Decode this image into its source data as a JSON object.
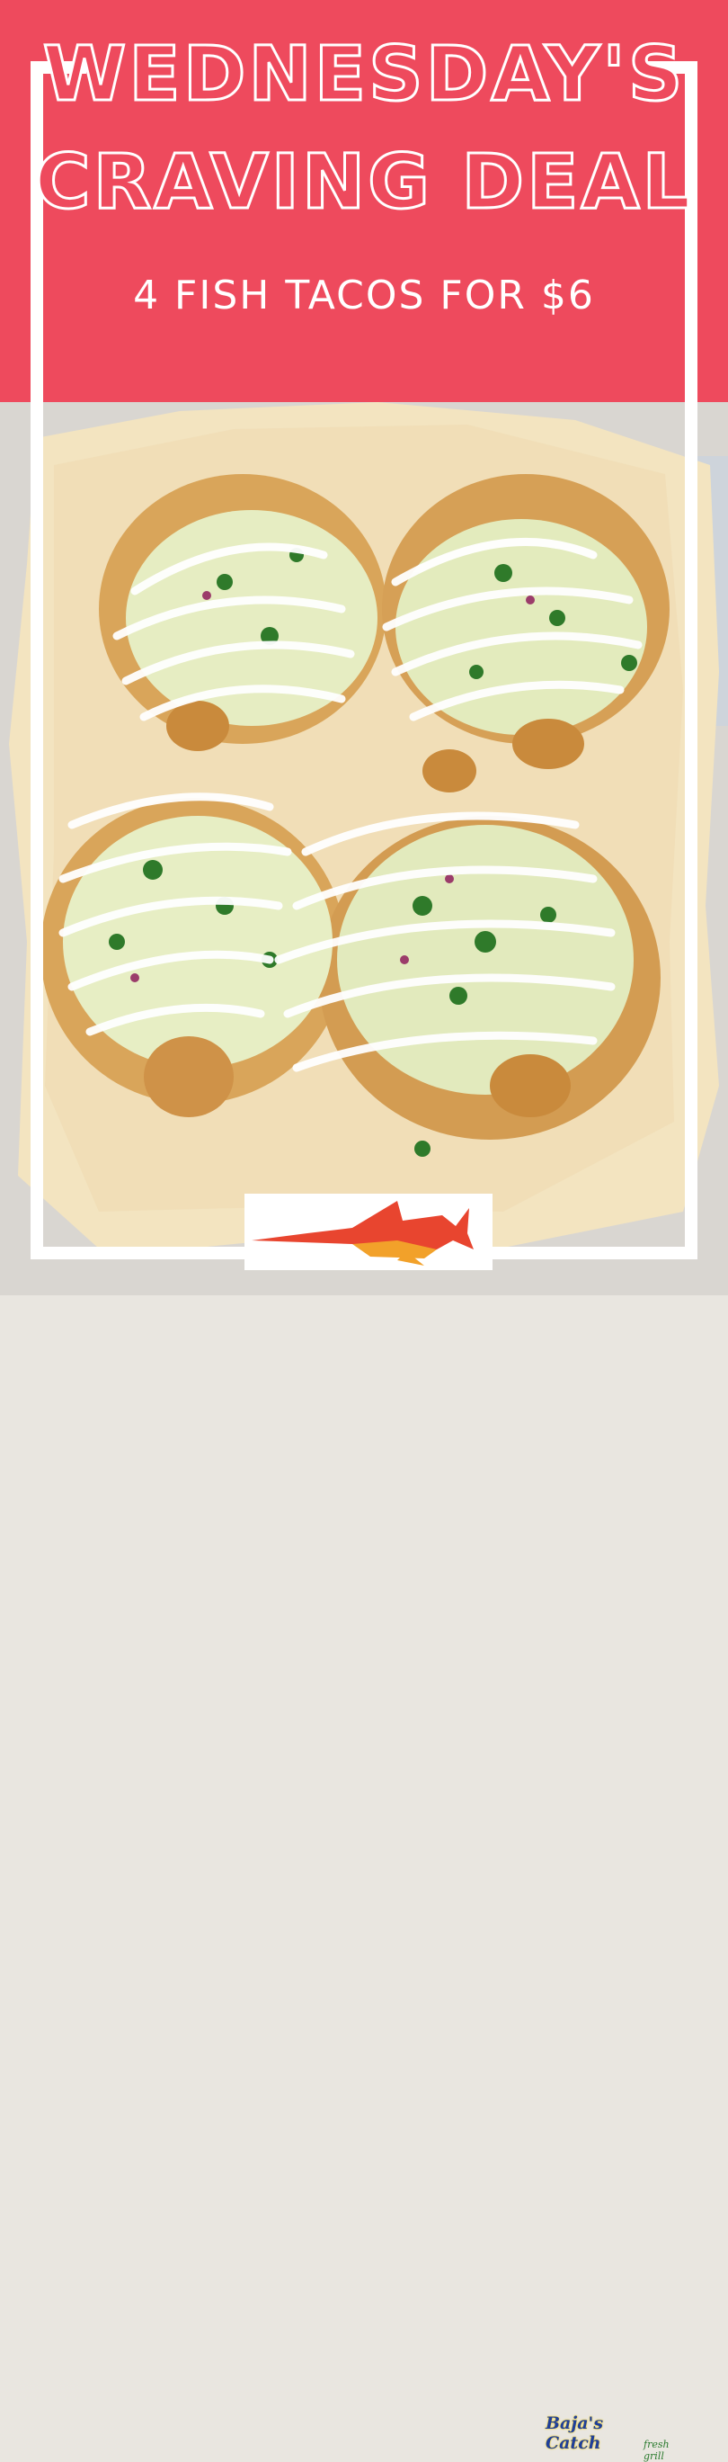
{
  "headline": {
    "line1": "WEDNESDAY'S",
    "line2": "CRAVING DEAL"
  },
  "offer": {
    "text": "4 FISH TACOS FOR $6"
  },
  "photo": {
    "subject": "fish-tacos-photo"
  },
  "logo": {
    "brand": "Baja's Catch",
    "tagline": "fresh grill"
  },
  "colors": {
    "banner": "#ee4a5d",
    "frame": "#ffffff",
    "paper": "#f4e6c4"
  }
}
